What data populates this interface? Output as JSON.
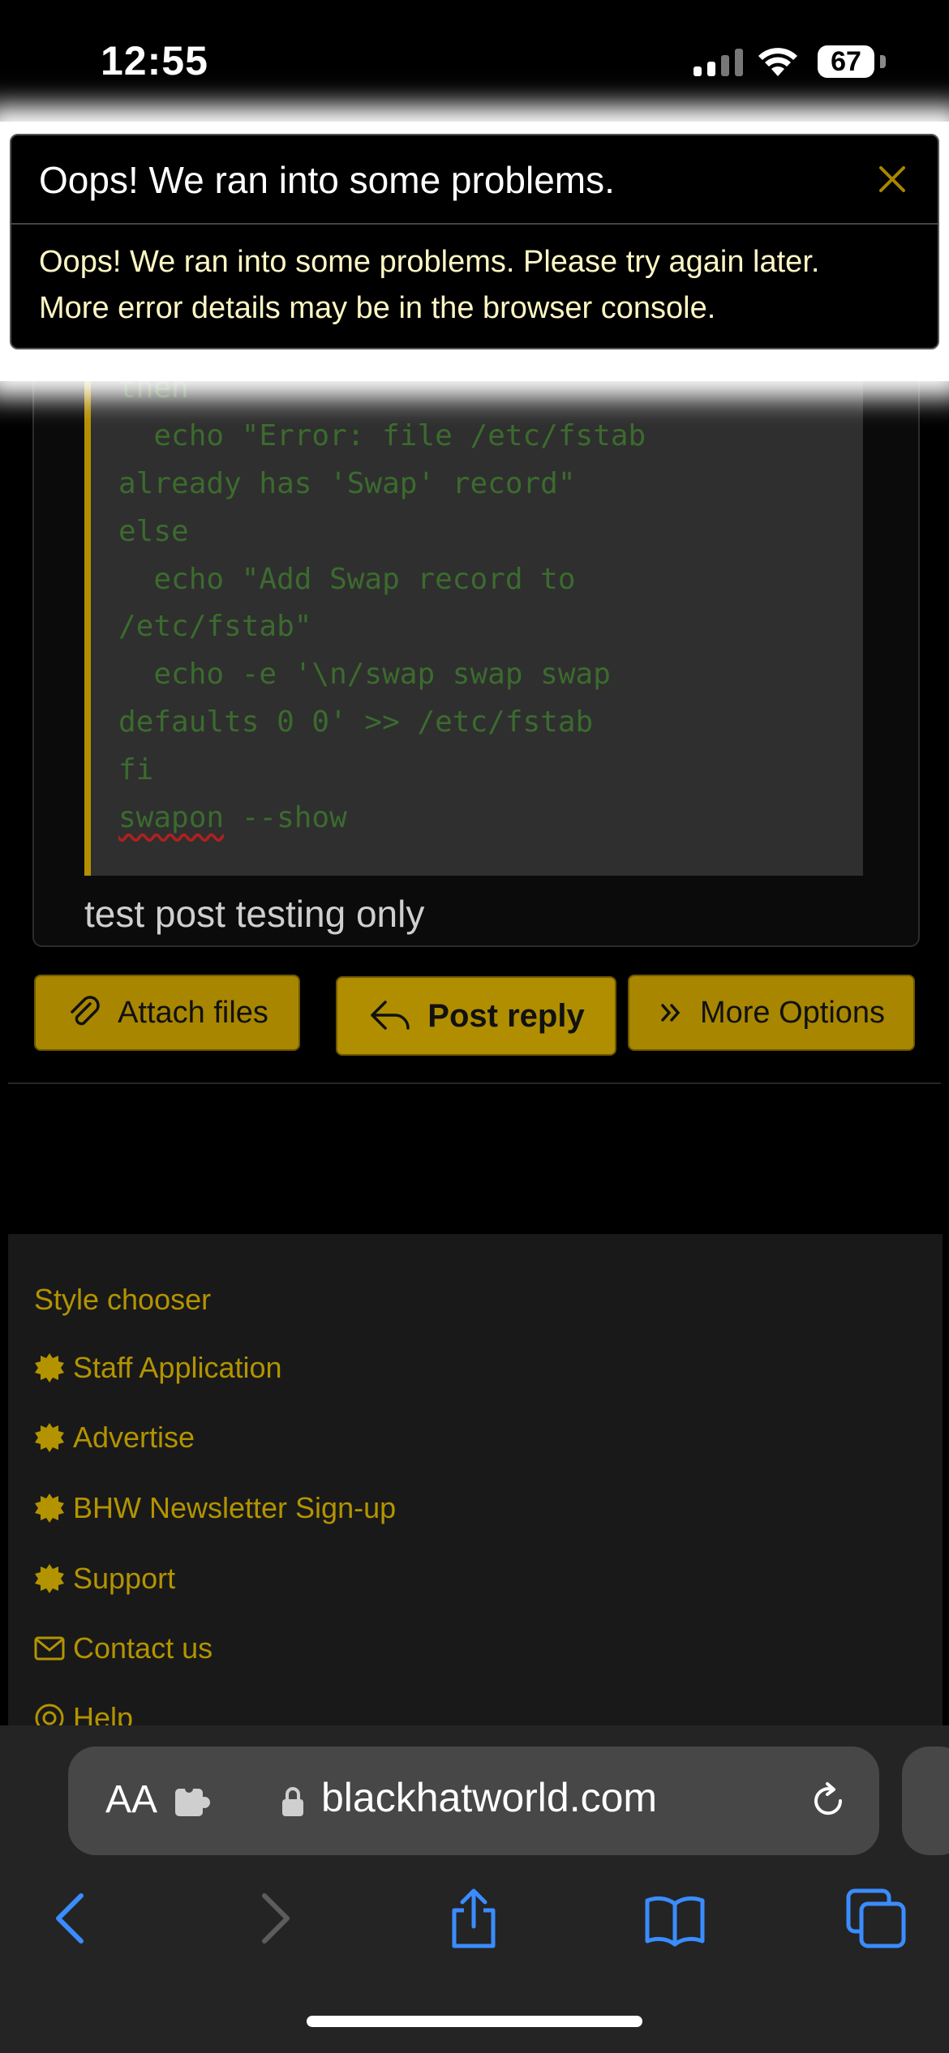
{
  "status_bar": {
    "time": "12:55",
    "battery": "67"
  },
  "toast": {
    "title": "Oops! We ran into some problems.",
    "message_line1": "Oops! We ran into some problems. Please try again later.",
    "message_line2": "More error details may be in the browser console."
  },
  "code_block": {
    "lines": [
      "then",
      "  echo \"Error: file /etc/fstab",
      "already has 'Swap' record\"",
      "else",
      "  echo \"Add Swap record to",
      "/etc/fstab\"",
      "  echo -e '\\n/swap swap swap",
      "defaults 0 0' >> /etc/fstab",
      "fi",
      "--show"
    ],
    "underlined_word": "swapon"
  },
  "post": {
    "text": "test post testing only"
  },
  "actions": {
    "attach_label": "Attach files",
    "reply_label": "Post reply",
    "more_label": "More Options"
  },
  "footer": {
    "style_chooser": "Style chooser",
    "links": [
      "Staff Application",
      "Advertise",
      "BHW Newsletter Sign-up",
      "Support",
      "Contact us",
      "Help"
    ]
  },
  "browser": {
    "aa_label": "AA",
    "domain": "blackhatworld.com"
  },
  "colors": {
    "accent": "#a88600",
    "link": "#b39400",
    "code_text": "#3b6b2e"
  }
}
